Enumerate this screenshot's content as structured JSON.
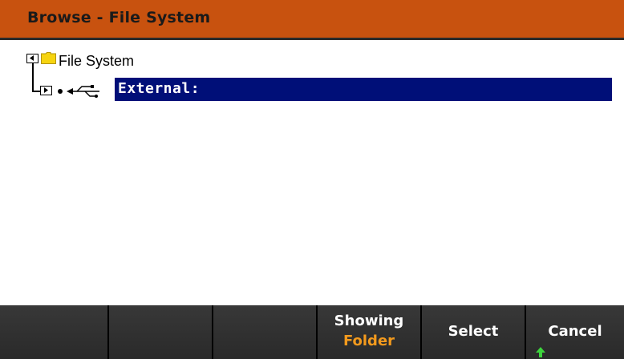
{
  "header": {
    "title": "Browse - File System"
  },
  "tree": {
    "root": {
      "label": "File System",
      "expander_state": "collapse",
      "icon": "folder-icon"
    },
    "child": {
      "label": "External:",
      "expander_state": "expand",
      "icon": "usb-icon",
      "selected": true
    }
  },
  "softkeys": [
    {
      "line1": "",
      "line2": ""
    },
    {
      "line1": "",
      "line2": ""
    },
    {
      "line1": "",
      "line2": ""
    },
    {
      "line1": "Showing",
      "line2": "Folder"
    },
    {
      "line1": "Select",
      "line2": ""
    },
    {
      "line1": "Cancel",
      "line2": ""
    }
  ],
  "colors": {
    "title_bar": "#c8520f",
    "selection": "#000f78",
    "softkey_value": "#f39a1d",
    "shift_arrow": "#3dd43d"
  }
}
